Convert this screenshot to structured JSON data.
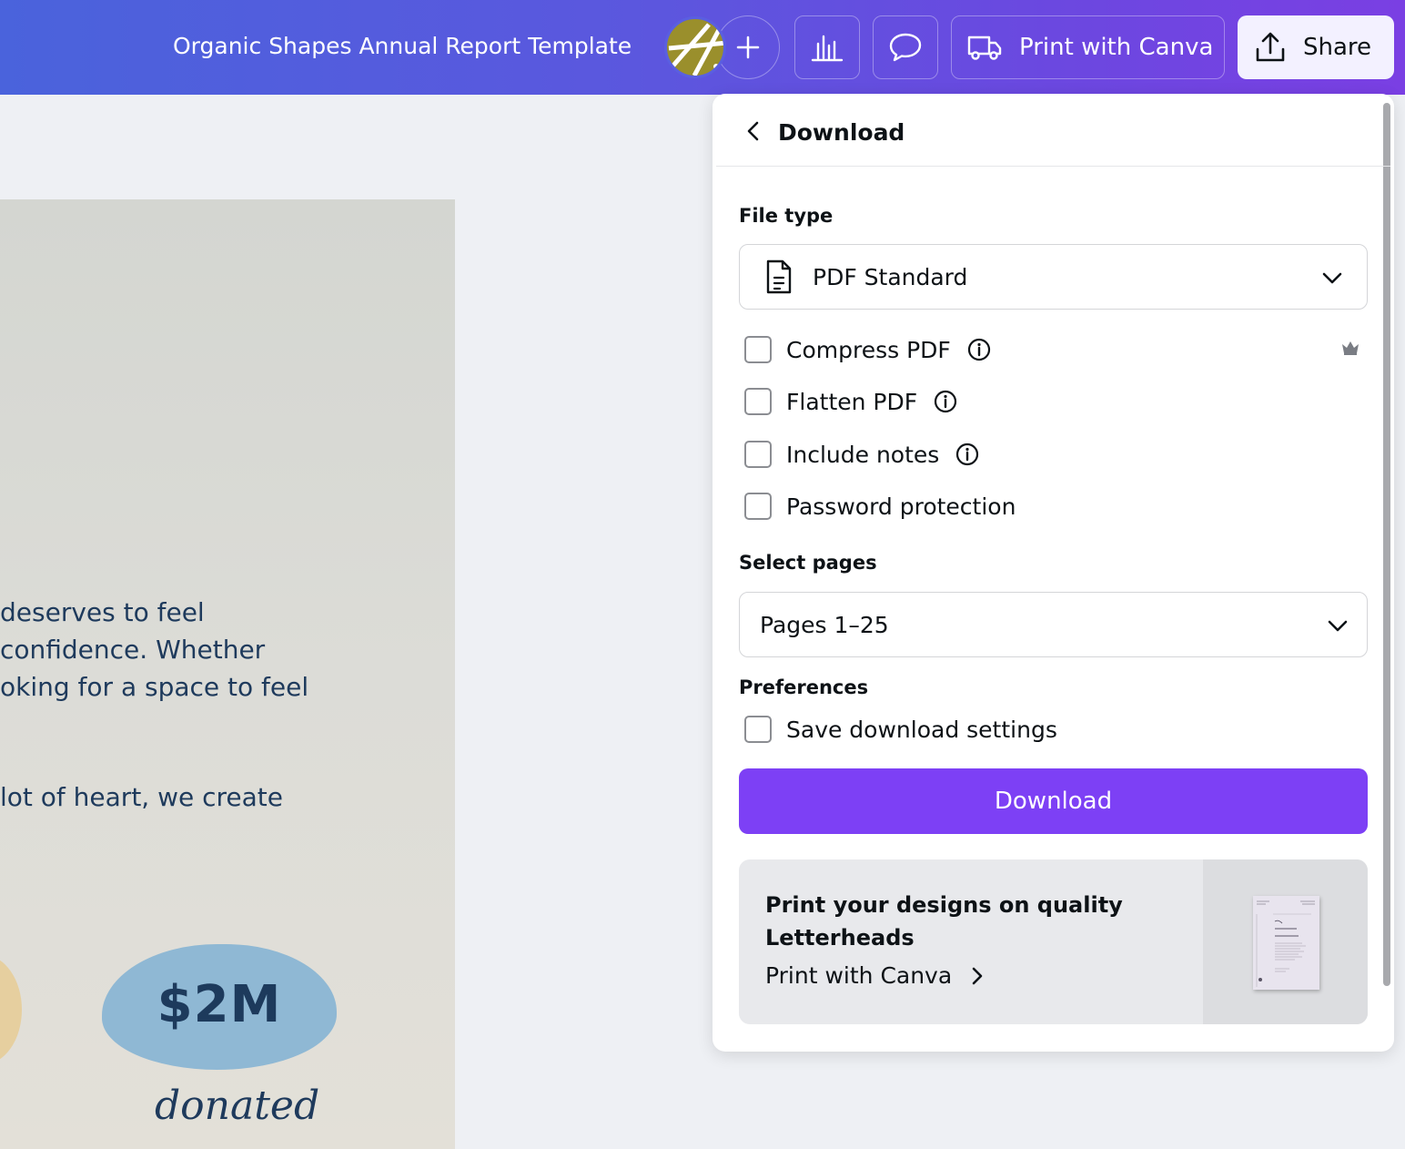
{
  "topbar": {
    "title": "Organic Shapes Annual Report Template",
    "print_label": "Print with Canva",
    "share_label": "Share"
  },
  "canvas": {
    "lines": [
      "deserves to feel",
      "confidence. Whether",
      "oking for a space to feel",
      "lot of heart, we create"
    ],
    "stat_value": "$2M",
    "stat_label": "donated"
  },
  "panel": {
    "title": "Download",
    "file_type_label": "File type",
    "file_type_value": "PDF Standard",
    "options": [
      {
        "label": "Compress PDF",
        "checked": false
      },
      {
        "label": "Flatten PDF",
        "checked": false
      },
      {
        "label": "Include notes",
        "checked": false
      },
      {
        "label": "Password protection",
        "checked": false
      }
    ],
    "select_pages_label": "Select pages",
    "pages_value": "Pages 1–25",
    "preferences_label": "Preferences",
    "save_settings_label": "Save download settings",
    "download_button": "Download",
    "promo": {
      "title": "Print your designs on quality Letterheads",
      "link": "Print with Canva"
    }
  },
  "colors": {
    "accent": "#7d40f5",
    "topbar_start": "#4a63dc",
    "topbar_end": "#7a3fe3"
  }
}
